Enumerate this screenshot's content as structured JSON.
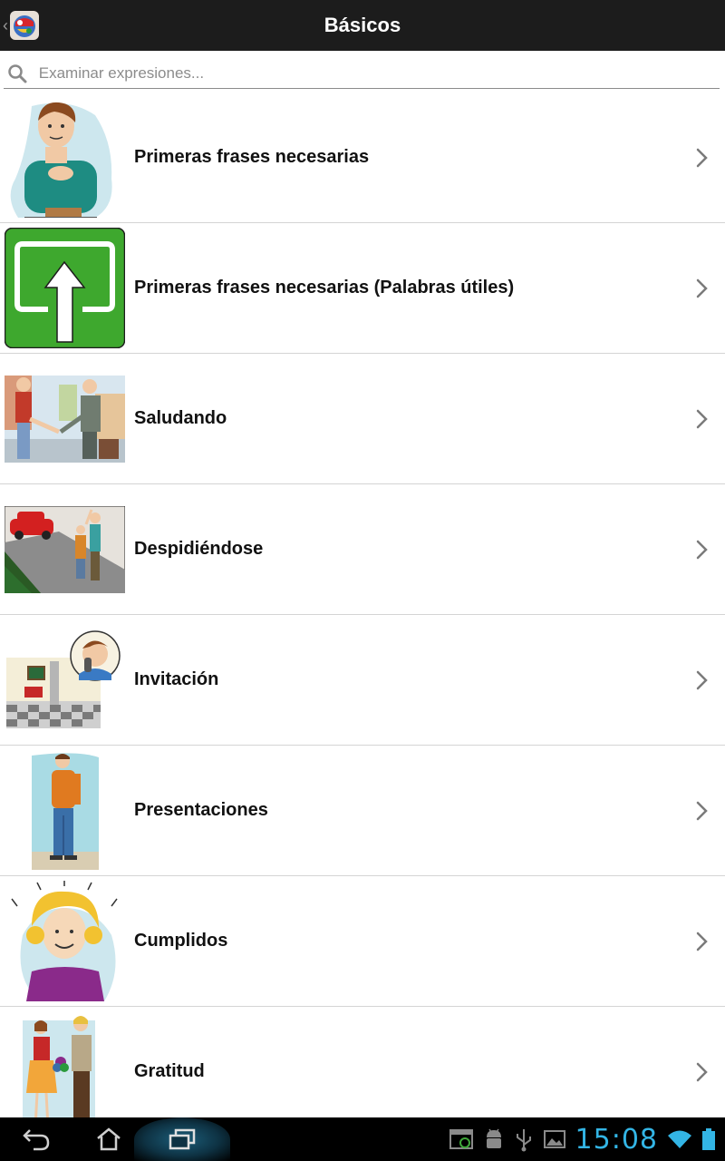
{
  "actionbar": {
    "title": "Básicos"
  },
  "search": {
    "placeholder": "Examinar expresiones..."
  },
  "list": {
    "items": [
      {
        "label": "Primeras frases necesarias"
      },
      {
        "label": "Primeras frases necesarias (Palabras útiles)"
      },
      {
        "label": "Saludando"
      },
      {
        "label": "Despidiéndose"
      },
      {
        "label": "Invitación"
      },
      {
        "label": "Presentaciones"
      },
      {
        "label": "Cumplidos"
      },
      {
        "label": "Gratitud"
      }
    ]
  },
  "statusbar": {
    "time": "15:08"
  },
  "colors": {
    "accent": "#33b5e5",
    "green": "#3ea82e",
    "bar": "#1c1c1c"
  }
}
